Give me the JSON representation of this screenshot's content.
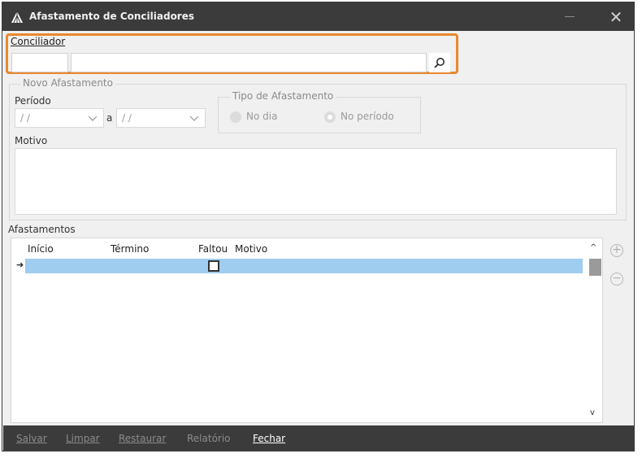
{
  "window": {
    "title": "Afastamento de Conciliadores"
  },
  "conciliador": {
    "label": "Conciliador",
    "code_value": "",
    "name_value": ""
  },
  "novo_afastamento": {
    "title": "Novo Afastamento",
    "periodo_label": "Período",
    "date_from": "/ /",
    "date_sep": "a",
    "date_to": "/ /",
    "tipo": {
      "title": "Tipo de Afastamento",
      "option_dia": "No dia",
      "option_periodo": "No período",
      "selected": "No período"
    },
    "motivo_label": "Motivo",
    "motivo_value": ""
  },
  "afastamentos": {
    "title": "Afastamentos",
    "columns": [
      "Início",
      "Término",
      "Faltou",
      "Motivo"
    ],
    "rows": [
      {
        "inicio": "",
        "termino": "",
        "faltou": false,
        "motivo": ""
      }
    ]
  },
  "toolbar": {
    "salvar": "Salvar",
    "limpar": "Limpar",
    "restaurar": "Restaurar",
    "relatorio": "Relatório",
    "fechar": "Fechar"
  },
  "colors": {
    "highlight": "#e8892f",
    "selected_row": "#9fcdf0",
    "bar": "#3b3b3b"
  }
}
